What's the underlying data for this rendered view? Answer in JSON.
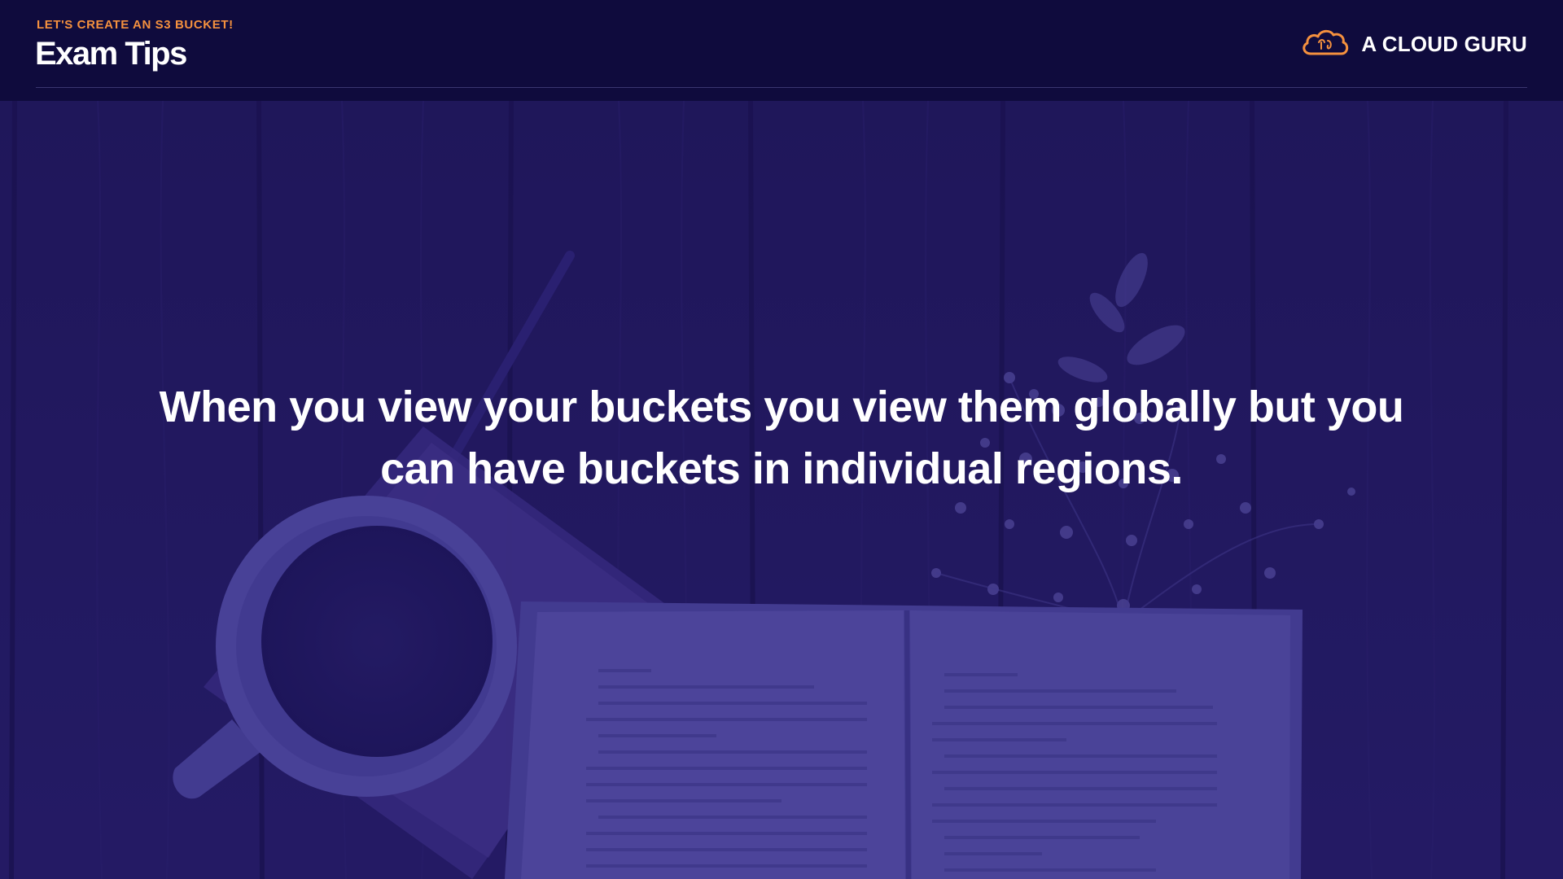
{
  "header": {
    "eyebrow": "LET'S CREATE AN S3 BUCKET!",
    "title": "Exam Tips"
  },
  "brand": {
    "name": "A CLOUD GURU",
    "logo_icon": "cloud-logo-icon",
    "accent_color": "#f5913e"
  },
  "main": {
    "statement": "When you view your buckets you view them globally but you can have buckets in individual regions."
  },
  "background": {
    "description_icon": "coffee-book-flowers-photo",
    "tint_color": "#2a1c78"
  }
}
